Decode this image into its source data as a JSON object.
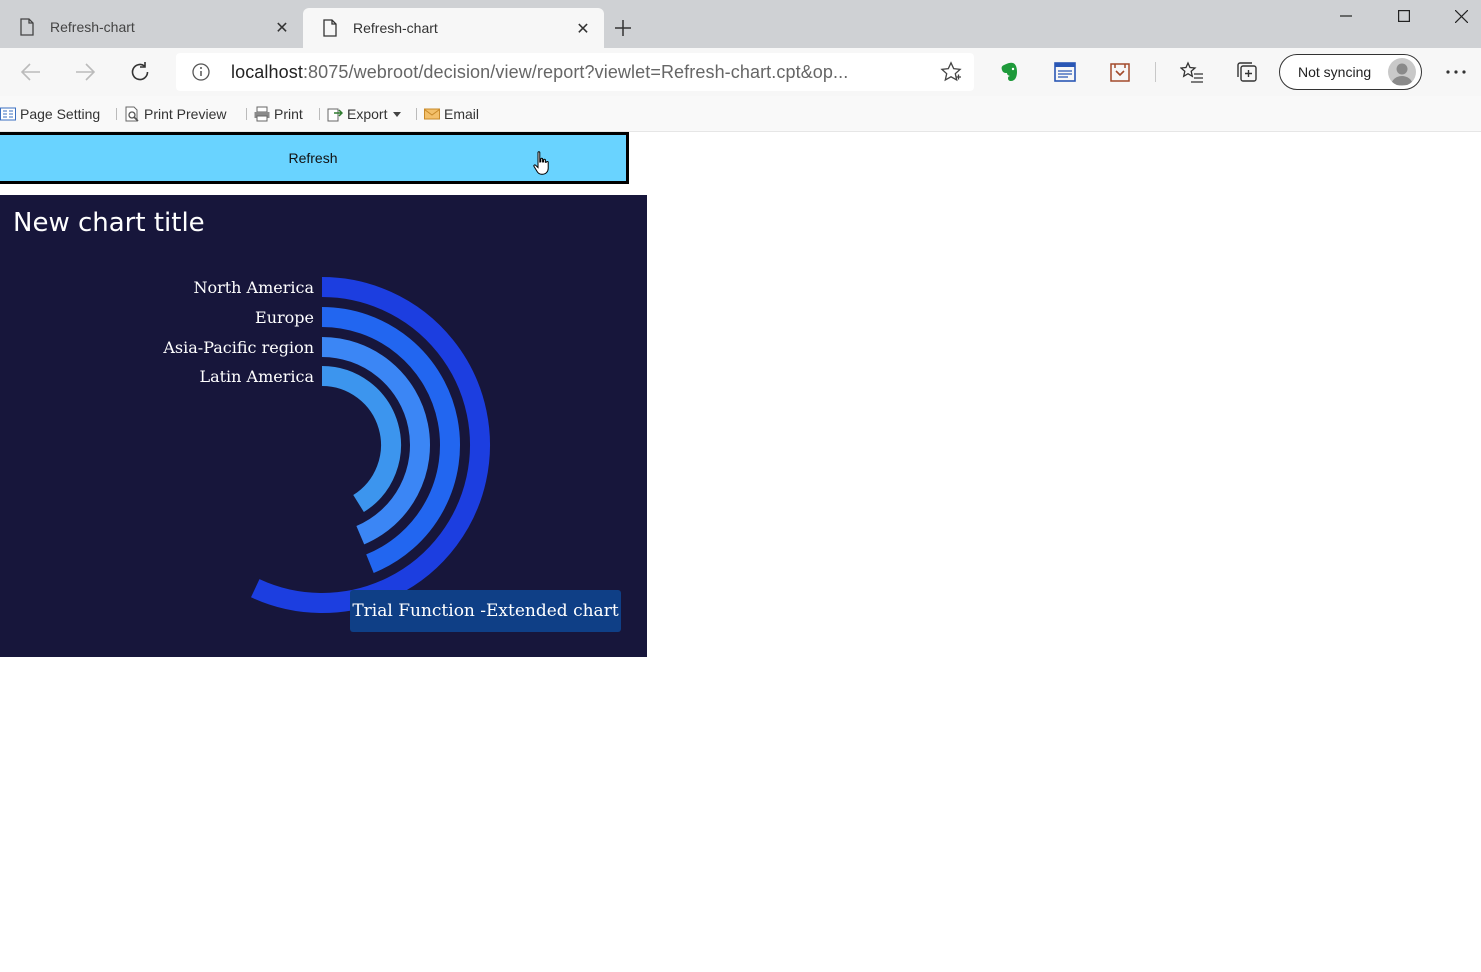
{
  "browser": {
    "tabs": [
      {
        "title": "Refresh-chart",
        "active": false
      },
      {
        "title": "Refresh-chart",
        "active": true
      }
    ],
    "url_host": "localhost",
    "url_rest": ":8075/webroot/decision/view/report?viewlet=Refresh-chart.cpt&op...",
    "profile_label": "Not syncing"
  },
  "report_toolbar": {
    "page_setting": "Page Setting",
    "print_preview": "Print Preview",
    "print": "Print",
    "export": "Export",
    "email": "Email"
  },
  "refresh_label": "Refresh",
  "chart_data": {
    "type": "radial-bar",
    "title": "New chart title",
    "series_names": [
      "North America",
      "Europe",
      "Asia-Pacific region",
      "Latin America"
    ],
    "values_degrees": [
      205,
      158,
      157,
      148
    ],
    "colors": [
      "#1c3ee0",
      "#2266f0",
      "#3b86f5",
      "#3c95ee"
    ],
    "watermark": "Trial Function -Extended chart"
  }
}
